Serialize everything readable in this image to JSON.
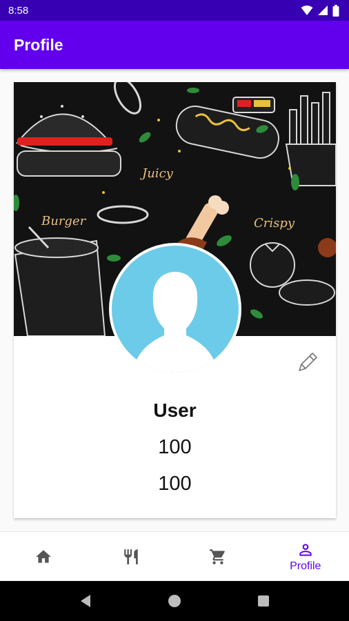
{
  "status_bar": {
    "time": "8:58"
  },
  "app_bar": {
    "title": "Profile"
  },
  "banner": {
    "labels": {
      "burger": "Burger",
      "juicy": "Juicy",
      "crispy": "Crispy"
    }
  },
  "profile": {
    "name": "User",
    "stat_1": "100",
    "stat_2": "100"
  },
  "bottom_nav": {
    "items": [
      {
        "icon": "home-icon",
        "label": ""
      },
      {
        "icon": "restaurant-icon",
        "label": ""
      },
      {
        "icon": "cart-icon",
        "label": ""
      },
      {
        "icon": "person-icon",
        "label": "Profile"
      }
    ],
    "active_color": "#6200ee",
    "inactive_color": "#555555"
  },
  "colors": {
    "status_bar": "#3700b3",
    "app_bar": "#6200ee",
    "avatar_bg": "#6ccbe8"
  }
}
